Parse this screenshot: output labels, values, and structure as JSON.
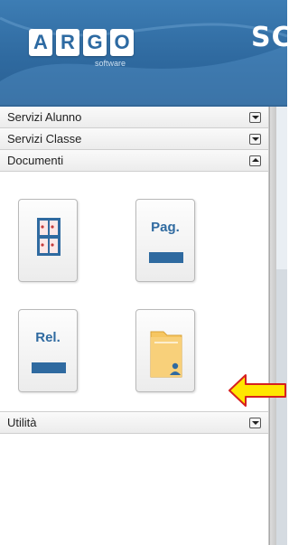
{
  "header": {
    "logo_letters": [
      "A",
      "R",
      "G",
      "O"
    ],
    "logo_subtitle": "software",
    "title_partial": "SC"
  },
  "sidebar": {
    "sections": [
      {
        "label": "Servizi Alunno",
        "state": "collapsed"
      },
      {
        "label": "Servizi Classe",
        "state": "collapsed"
      },
      {
        "label": "Documenti",
        "state": "expanded"
      },
      {
        "label": "Utilità",
        "state": "collapsed"
      }
    ],
    "documents": [
      {
        "icon": "grid-document-icon"
      },
      {
        "label": "Pag.",
        "icon": "page-icon"
      },
      {
        "label": "Rel.",
        "icon": "report-icon"
      },
      {
        "icon": "user-folder-icon"
      }
    ]
  },
  "colors": {
    "brand_blue": "#2f6aa0",
    "folder_yellow": "#f6c661",
    "arrow_yellow": "#ffe600",
    "arrow_border": "#d62020"
  }
}
